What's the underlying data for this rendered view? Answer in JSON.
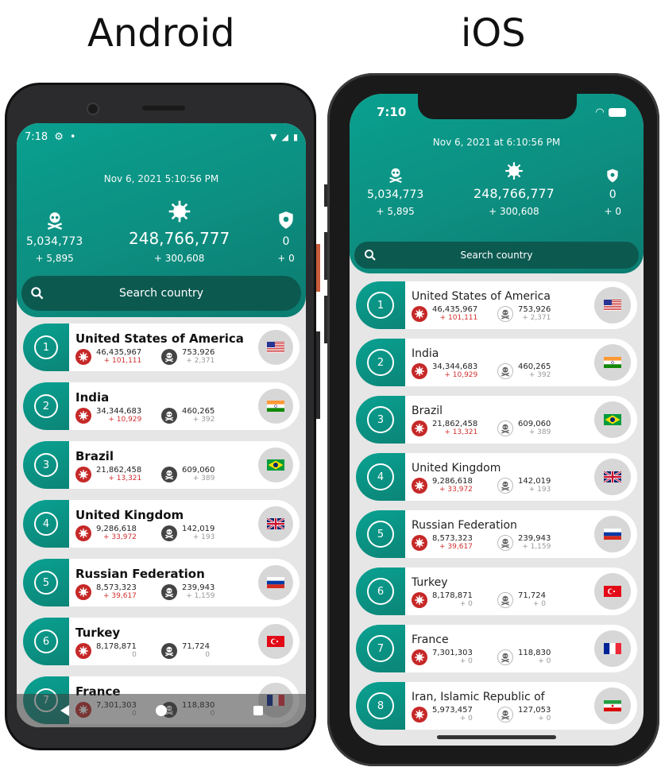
{
  "titles": {
    "android": "Android",
    "ios": "iOS"
  },
  "colors": {
    "teal": "#0b9586",
    "search": "#0c5950",
    "increase": "#d32f2f"
  },
  "android": {
    "status": {
      "time": "7:18"
    },
    "datetime": "Nov 6, 2021 5:10:56 PM",
    "stats": {
      "deaths": {
        "value": "5,034,773",
        "delta": "+ 5,895",
        "icon": "skull-icon"
      },
      "cases": {
        "value": "248,766,777",
        "delta": "+ 300,608",
        "icon": "virus-icon"
      },
      "recovered": {
        "value": "0",
        "delta": "+ 0",
        "icon": "shield-icon"
      }
    },
    "search_placeholder": "Search country",
    "rows": [
      {
        "rank": "1",
        "country": "United States of America",
        "cases": "46,435,967",
        "cases_delta": "+ 101,111",
        "deaths": "753,926",
        "deaths_delta": "+ 2,371",
        "flag": "us"
      },
      {
        "rank": "2",
        "country": "India",
        "cases": "34,344,683",
        "cases_delta": "+ 10,929",
        "deaths": "460,265",
        "deaths_delta": "+ 392",
        "flag": "in"
      },
      {
        "rank": "3",
        "country": "Brazil",
        "cases": "21,862,458",
        "cases_delta": "+ 13,321",
        "deaths": "609,060",
        "deaths_delta": "+ 389",
        "flag": "br"
      },
      {
        "rank": "4",
        "country": "United Kingdom",
        "cases": "9,286,618",
        "cases_delta": "+ 33,972",
        "deaths": "142,019",
        "deaths_delta": "+ 193",
        "flag": "gb"
      },
      {
        "rank": "5",
        "country": "Russian Federation",
        "cases": "8,573,323",
        "cases_delta": "+ 39,617",
        "deaths": "239,943",
        "deaths_delta": "+ 1,159",
        "flag": "ru"
      },
      {
        "rank": "6",
        "country": "Turkey",
        "cases": "8,178,871",
        "cases_delta": "0",
        "deaths": "71,724",
        "deaths_delta": "0",
        "flag": "tr"
      },
      {
        "rank": "7",
        "country": "France",
        "cases": "7,301,303",
        "cases_delta": "0",
        "deaths": "118,830",
        "deaths_delta": "0",
        "flag": "fr"
      }
    ]
  },
  "ios": {
    "status": {
      "time": "7:10"
    },
    "datetime": "Nov 6, 2021 at 6:10:56 PM",
    "stats": {
      "deaths": {
        "value": "5,034,773",
        "delta": "+ 5,895",
        "icon": "skull-icon"
      },
      "cases": {
        "value": "248,766,777",
        "delta": "+ 300,608",
        "icon": "virus-icon"
      },
      "recovered": {
        "value": "0",
        "delta": "+ 0",
        "icon": "shield-icon"
      }
    },
    "search_placeholder": "Search country",
    "rows": [
      {
        "rank": "1",
        "country": "United States of America",
        "cases": "46,435,967",
        "cases_delta": "+ 101,111",
        "deaths": "753,926",
        "deaths_delta": "+ 2,371",
        "flag": "us"
      },
      {
        "rank": "2",
        "country": "India",
        "cases": "34,344,683",
        "cases_delta": "+ 10,929",
        "deaths": "460,265",
        "deaths_delta": "+ 392",
        "flag": "in"
      },
      {
        "rank": "3",
        "country": "Brazil",
        "cases": "21,862,458",
        "cases_delta": "+ 13,321",
        "deaths": "609,060",
        "deaths_delta": "+ 389",
        "flag": "br"
      },
      {
        "rank": "4",
        "country": "United Kingdom",
        "cases": "9,286,618",
        "cases_delta": "+ 33,972",
        "deaths": "142,019",
        "deaths_delta": "+ 193",
        "flag": "gb"
      },
      {
        "rank": "5",
        "country": "Russian Federation",
        "cases": "8,573,323",
        "cases_delta": "+ 39,617",
        "deaths": "239,943",
        "deaths_delta": "+ 1,159",
        "flag": "ru"
      },
      {
        "rank": "6",
        "country": "Turkey",
        "cases": "8,178,871",
        "cases_delta": "+ 0",
        "deaths": "71,724",
        "deaths_delta": "+ 0",
        "flag": "tr"
      },
      {
        "rank": "7",
        "country": "France",
        "cases": "7,301,303",
        "cases_delta": "+ 0",
        "deaths": "118,830",
        "deaths_delta": "+ 0",
        "flag": "fr"
      },
      {
        "rank": "8",
        "country": "Iran, Islamic Republic of",
        "cases": "5,973,457",
        "cases_delta": "+ 0",
        "deaths": "127,053",
        "deaths_delta": "+ 0",
        "flag": "ir"
      }
    ]
  }
}
